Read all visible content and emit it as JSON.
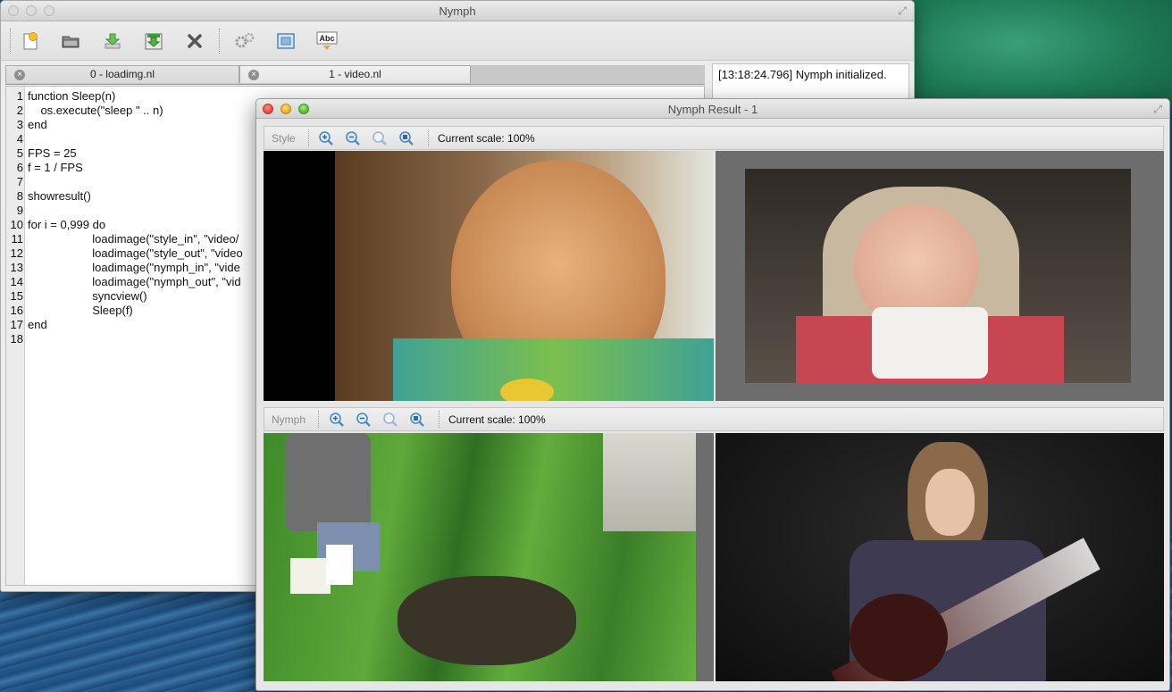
{
  "main_window": {
    "title": "Nymph",
    "toolbar": [
      {
        "name": "new-file-icon",
        "color": "#f2c230"
      },
      {
        "name": "open-folder-icon",
        "color": "#6a6a6a"
      },
      {
        "name": "download-icon",
        "color": "#5fb34a"
      },
      {
        "name": "save-download-icon",
        "color": "#3c9c35"
      },
      {
        "name": "close-x-icon",
        "color": "#555555"
      },
      {
        "name": "settings-icon",
        "color": "#9a9a9a"
      },
      {
        "name": "frame-view-icon",
        "color": "#4b88c2"
      },
      {
        "name": "spellcheck-icon",
        "label": "Abc"
      }
    ],
    "tabs": [
      {
        "label": "0 - loadimg.nl",
        "close": "×"
      },
      {
        "label": "1 - video.nl",
        "close": "×"
      }
    ],
    "code_lines": [
      {
        "n": "1",
        "text": "function Sleep(n)"
      },
      {
        "n": "2",
        "text": "    os.execute(\"sleep \" .. n)"
      },
      {
        "n": "3",
        "text": "end"
      },
      {
        "n": "4",
        "text": ""
      },
      {
        "n": "5",
        "text": "FPS = 25"
      },
      {
        "n": "6",
        "text": "f = 1 / FPS"
      },
      {
        "n": "7",
        "text": ""
      },
      {
        "n": "8",
        "text": "showresult()"
      },
      {
        "n": "9",
        "text": ""
      },
      {
        "n": "10",
        "text": "for i = 0,999 do"
      },
      {
        "n": "11",
        "text": "                    loadimage(\"style_in\", \"video/"
      },
      {
        "n": "12",
        "text": "                    loadimage(\"style_out\", \"video"
      },
      {
        "n": "13",
        "text": "                    loadimage(\"nymph_in\", \"vide"
      },
      {
        "n": "14",
        "text": "                    loadimage(\"nymph_out\", \"vid"
      },
      {
        "n": "15",
        "text": "                    syncview()"
      },
      {
        "n": "16",
        "text": "                    Sleep(f)"
      },
      {
        "n": "17",
        "text": "end"
      },
      {
        "n": "18",
        "text": ""
      }
    ],
    "log_text": "[13:18:24.796] Nymph initialized."
  },
  "result_window": {
    "title": "Nymph Result - 1",
    "panels": [
      {
        "label": "Style",
        "scale_text": "Current scale: 100%"
      },
      {
        "label": "Nymph",
        "scale_text": "Current scale: 100%"
      }
    ],
    "zoom_icons": [
      "zoom-in-icon",
      "zoom-out-icon",
      "zoom-fit-icon",
      "zoom-actual-icon"
    ]
  },
  "colors": {
    "accent_blue": "#4b88c2",
    "frame_gray": "#6d6d6d"
  }
}
